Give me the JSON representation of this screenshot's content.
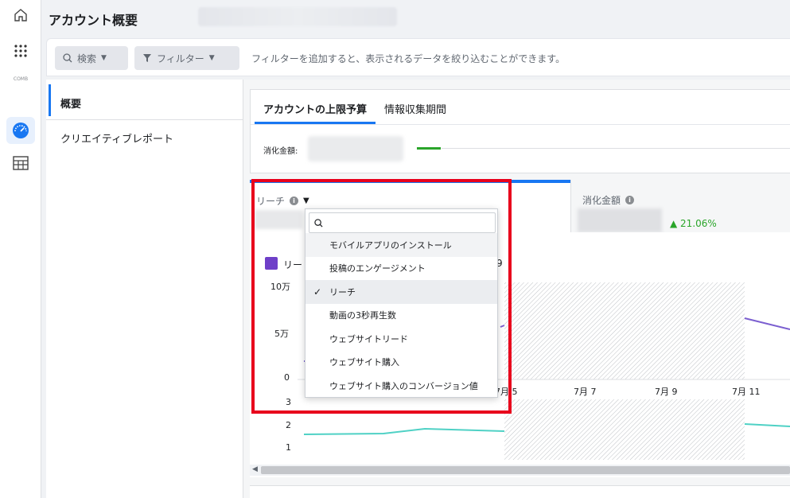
{
  "header": {
    "title": "アカウント概要"
  },
  "rail": {
    "logo_text": "COMB",
    "items": [
      "home-icon",
      "apps-grid-icon",
      "logo",
      "dashboard-icon",
      "table-icon"
    ]
  },
  "filterbar": {
    "search_label": "検索",
    "filter_label": "フィルター",
    "hint": "フィルターを追加すると、表示されるデータを絞り込むことができます。"
  },
  "leftnav": {
    "items": [
      {
        "label": "概要",
        "active": true
      },
      {
        "label": "クリエイティブレポート",
        "active": false
      }
    ]
  },
  "tabs": [
    {
      "label": "アカウントの上限予算",
      "active": true
    },
    {
      "label": "情報収集期間",
      "active": false
    }
  ],
  "budget": {
    "label": "消化金額:"
  },
  "metrics": [
    {
      "label": "リーチ",
      "selected": true
    },
    {
      "label": "消化金額",
      "delta": "▲ 21.06%"
    }
  ],
  "chart": {
    "legend_prefix": "リー",
    "legend_suffix": "9",
    "y_ticks_top": [
      "10万",
      "5万",
      "0"
    ],
    "y_ticks_bottom": [
      "3",
      "2",
      "1"
    ],
    "x_ticks": [
      "7月 5",
      "7月 7",
      "7月 9",
      "7月 11"
    ]
  },
  "dropdown": {
    "search_value": "",
    "items": [
      {
        "label": "モバイルアプリのインストール",
        "selected": false,
        "hover": true
      },
      {
        "label": "投稿のエンゲージメント",
        "selected": false,
        "hover": false
      },
      {
        "label": "リーチ",
        "selected": true,
        "hover": false
      },
      {
        "label": "動画の3秒再生数",
        "selected": false,
        "hover": false
      },
      {
        "label": "ウェブサイトリード",
        "selected": false,
        "hover": false
      },
      {
        "label": "ウェブサイト購入",
        "selected": false,
        "hover": false
      },
      {
        "label": "ウェブサイト購入のコンバージョン値",
        "selected": false,
        "hover": false
      }
    ]
  },
  "colors": {
    "accent": "#1877f2",
    "positive": "#2aa52a",
    "series_purple": "#6e3fc8",
    "series_teal": "#4fd1c5",
    "highlight_frame": "#e8001c"
  }
}
